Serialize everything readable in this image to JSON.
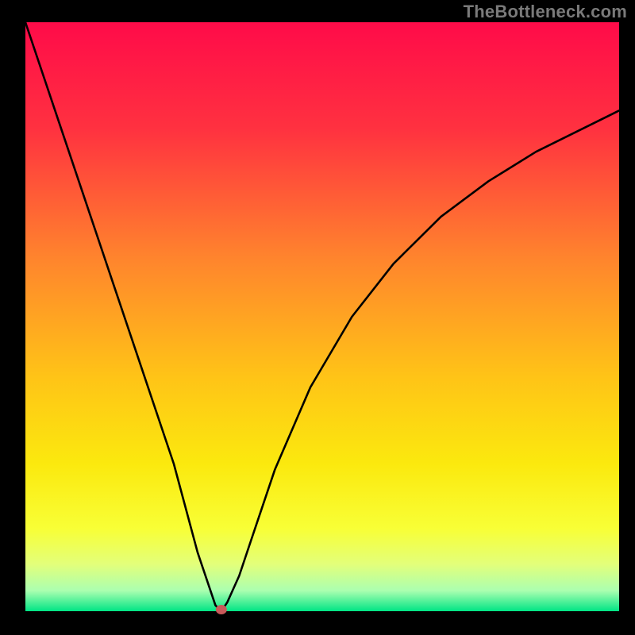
{
  "watermark": "TheBottleneck.com",
  "overlay": {
    "marker": {
      "x_pct": 33,
      "rx": 7,
      "ry": 6,
      "fill": "#c85a5a"
    }
  },
  "chart_data": {
    "type": "line",
    "title": "",
    "xlabel": "",
    "ylabel": "",
    "xlim": [
      0,
      100
    ],
    "ylim": [
      0,
      100
    ],
    "grid": false,
    "legend": null,
    "annotations": [
      {
        "text": "TheBottleneck.com",
        "position": "top-right"
      }
    ],
    "background_gradient": {
      "type": "vertical",
      "stops": [
        {
          "offset": 0.0,
          "color": "#ff0b49"
        },
        {
          "offset": 0.18,
          "color": "#ff3140"
        },
        {
          "offset": 0.4,
          "color": "#ff842d"
        },
        {
          "offset": 0.6,
          "color": "#ffc317"
        },
        {
          "offset": 0.75,
          "color": "#fbe90e"
        },
        {
          "offset": 0.86,
          "color": "#f8ff36"
        },
        {
          "offset": 0.92,
          "color": "#e3ff7a"
        },
        {
          "offset": 0.965,
          "color": "#abffb0"
        },
        {
          "offset": 1.0,
          "color": "#00e585"
        }
      ]
    },
    "series": [
      {
        "name": "bottleneck-curve",
        "x": [
          0,
          5,
          10,
          15,
          20,
          25,
          29,
          31,
          32,
          33,
          34,
          36,
          38,
          42,
          48,
          55,
          62,
          70,
          78,
          86,
          94,
          100
        ],
        "y": [
          100,
          85,
          70,
          55,
          40,
          25,
          10,
          4,
          1,
          0,
          1.5,
          6,
          12,
          24,
          38,
          50,
          59,
          67,
          73,
          78,
          82,
          85
        ]
      }
    ],
    "marker": {
      "x": 33,
      "y": 0,
      "color": "#c85a5a"
    }
  }
}
